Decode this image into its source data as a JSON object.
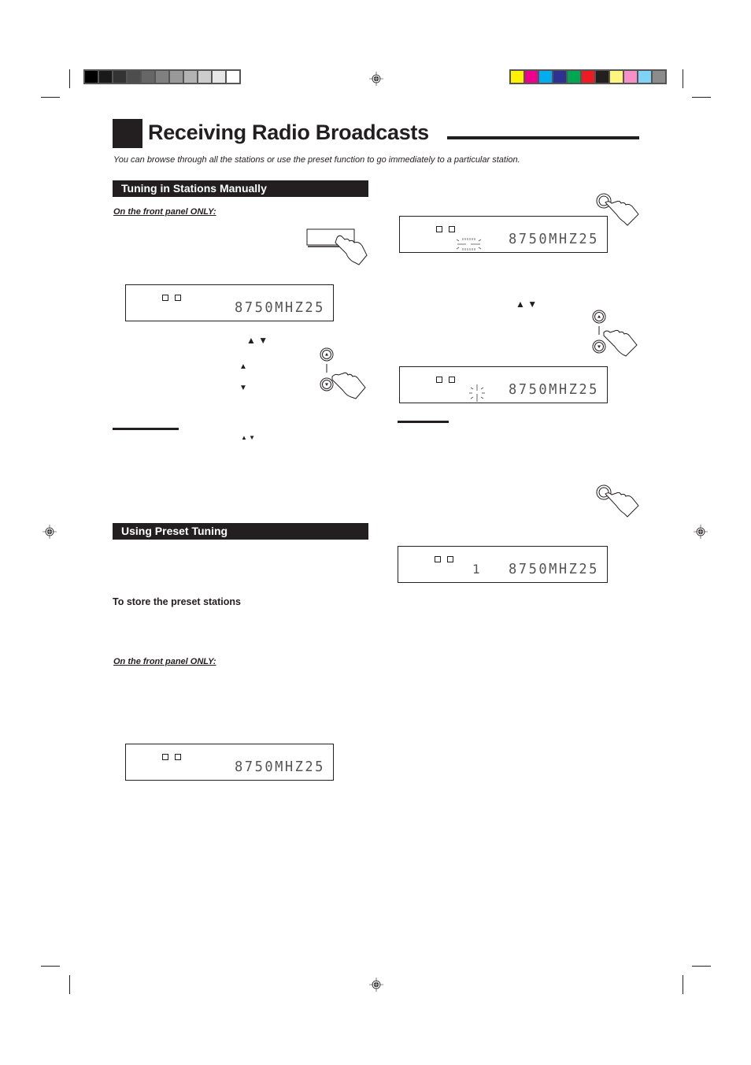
{
  "registration": {
    "gray_swatches": [
      "#000000",
      "#1a1a1a",
      "#333333",
      "#4d4d4d",
      "#666666",
      "#808080",
      "#999999",
      "#b3b3b3",
      "#cccccc",
      "#e6e6e6",
      "#ffffff"
    ],
    "color_swatches": [
      "#fff200",
      "#ec008c",
      "#00aeef",
      "#2e3192",
      "#00a651",
      "#ed1c24",
      "#231f20",
      "#fff67e",
      "#f78fc8",
      "#7fd3f7",
      "#8c8c8c"
    ]
  },
  "header": {
    "title": "Receiving Radio Broadcasts",
    "intro": "You can browse through all the stations or use the preset function to go immediately to a particular station."
  },
  "left": {
    "section1": {
      "heading": "Tuning in Stations Manually",
      "note": "On the front panel ONLY:",
      "display": {
        "readout": "8750MHZ25"
      },
      "arrows_label": "▲ ▼",
      "up_arrow": "▲",
      "down_arrow": "▼",
      "small_arrows": "▲ ▼"
    },
    "section2": {
      "heading": "Using Preset Tuning",
      "subheading": "To store the preset stations",
      "note": "On the front panel ONLY:",
      "display": {
        "readout": "8750MHZ25"
      }
    }
  },
  "right": {
    "display1": {
      "readout": "8750MHZ25",
      "blink_symbol": "-- --"
    },
    "arrows_label": "▲ ▼",
    "display2": {
      "readout": "8750MHZ25",
      "blink_symbol": "¦"
    },
    "display3": {
      "readout": "8750MHZ25",
      "preset_number": "1"
    }
  }
}
